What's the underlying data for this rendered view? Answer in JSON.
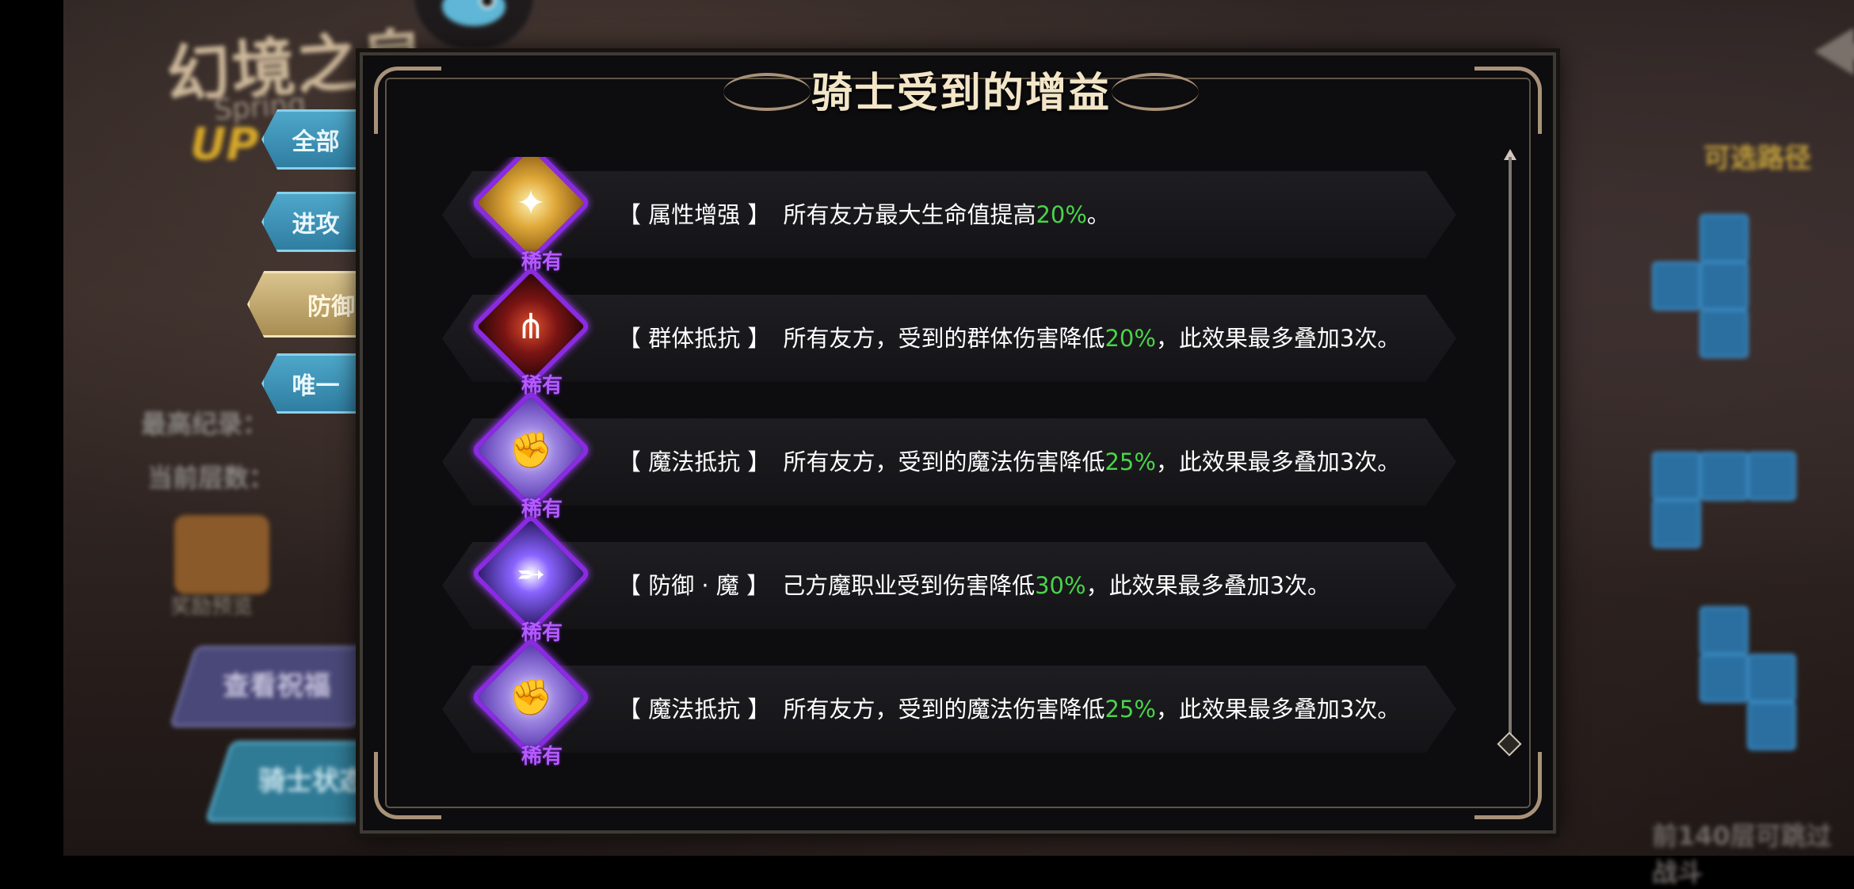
{
  "modal": {
    "title": "骑士受到的增益",
    "rows": [
      {
        "name": "【 属性增强 】",
        "pre": "所有友方最大生命值提高",
        "pct": "20%",
        "post": "。",
        "rarity": "稀有",
        "badge": "gold",
        "icon": "sparkle-orb-icon"
      },
      {
        "name": "【 群体抵抗 】",
        "pre": "所有友方，受到的群体伤害降低",
        "pct": "20%",
        "post": "，此效果最多叠加3次。",
        "rarity": "稀有",
        "badge": "red",
        "icon": "claw-spikes-icon"
      },
      {
        "name": "【 魔法抵抗 】",
        "pre": "所有友方，受到的魔法伤害降低",
        "pct": "25%",
        "post": "，此效果最多叠加3次。",
        "rarity": "稀有",
        "badge": "lilac",
        "icon": "magic-fist-icon"
      },
      {
        "name": "【 防御 · 魔 】",
        "pre": "己方魔职业受到伤害降低",
        "pct": "30%",
        "post": "，此效果最多叠加3次。",
        "rarity": "稀有",
        "badge": "violet",
        "icon": "arcane-bolt-icon"
      },
      {
        "name": "【 魔法抵抗 】",
        "pre": "所有友方，受到的魔法伤害降低",
        "pct": "25%",
        "post": "，此效果最多叠加3次。",
        "rarity": "稀有",
        "badge": "lilac",
        "icon": "magic-fist-icon"
      }
    ]
  },
  "tabs": [
    "全部",
    "进攻",
    "防御",
    "唯一"
  ],
  "active_tab": "防御",
  "colors": {
    "highlight_percent": "#4ad34a",
    "rarity": "#b45cff",
    "tab_blue": "#3b93b8",
    "tab_gold": "#c9b078"
  }
}
